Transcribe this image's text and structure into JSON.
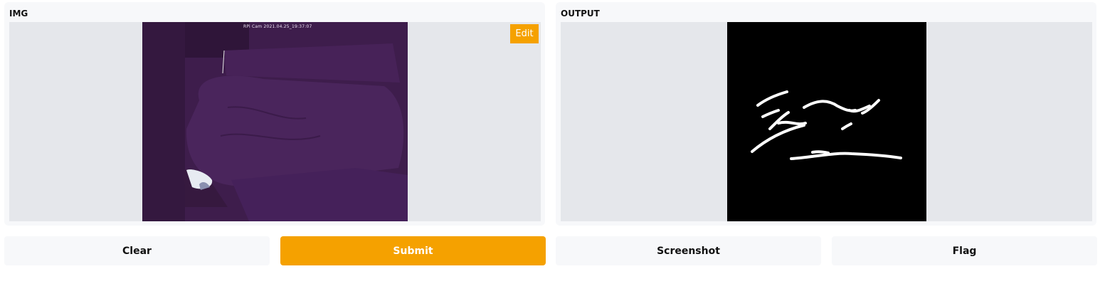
{
  "input_panel": {
    "label": "IMG",
    "edit_label": "Edit",
    "image": {
      "description_icon": "camera-photo",
      "overlay_text": "RPi Cam 2021.04.25_19:37:07"
    }
  },
  "output_panel": {
    "label": "OUTPUT",
    "image": {
      "description_icon": "segmentation-mask"
    }
  },
  "buttons": {
    "clear": "Clear",
    "submit": "Submit",
    "screenshot": "Screenshot",
    "flag": "Flag"
  },
  "colors": {
    "accent": "#f5a100",
    "panel_bg": "#f7f8fa",
    "stage_bg": "#e5e7eb",
    "photo_purple": "#3f1f4f",
    "mask_black": "#000000",
    "mask_white": "#ffffff"
  }
}
